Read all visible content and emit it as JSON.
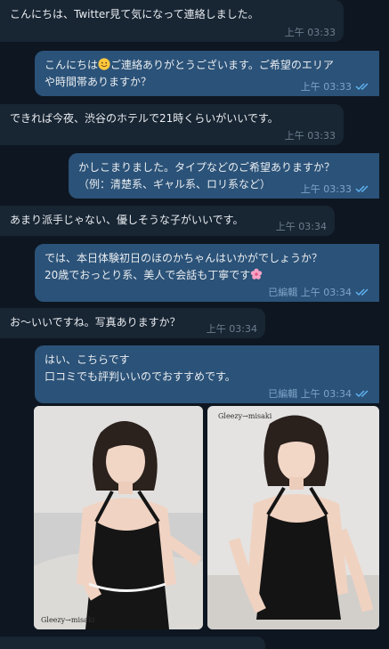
{
  "messages": [
    {
      "text": "こんにちは、Twitter見て気になって連絡しました。",
      "time": "上午 03:33"
    },
    {
      "line1": "こんにちは",
      "line1_rest": "ご連絡ありがとうございます。ご希望のエリア",
      "line2": "や時間帯ありますか？",
      "time": "上午 03:33",
      "emoji": "smile-emoji"
    },
    {
      "text": "できれば今夜、渋谷のホテルで21時くらいがいいです。",
      "time": "上午 03:33"
    },
    {
      "line1": "かしこまりました。タイプなどのご希望ありますか？",
      "line2": "（例：清楚系、ギャル系、ロリ系など）",
      "time": "上午 03:33"
    },
    {
      "text": "あまり派手じゃない、優しそうな子がいいです。",
      "time": "上午 03:34"
    },
    {
      "line1": "では、本日体験初日のほのかちゃんはいかがでしょうか？",
      "line2": "20歳でおっとり系、美人で会話も丁寧です",
      "edited": "已編輯",
      "time": "上午 03:34",
      "emoji": "cherry-blossom-emoji"
    },
    {
      "text": "お～いいですね。写真ありますか？",
      "time": "上午 03:34"
    },
    {
      "line1": "はい、こちらです",
      "line2": "口コミでも評判いいのでおすすめです。",
      "edited": "已編輯",
      "time": "上午 03:34"
    }
  ],
  "photos": [
    {
      "watermark": "Gleezy→misaki",
      "subject": "woman-in-black-dress-photo"
    },
    {
      "watermark": "Gleezy→misaki",
      "subject": "woman-in-black-dress-photo"
    }
  ],
  "icons": {
    "read": "double-check-icon"
  },
  "colors": {
    "background": "#0e1621",
    "incoming": "#182533",
    "outgoing": "#2b5278",
    "text": "#e9edf1",
    "check": "#5fb2f0"
  }
}
